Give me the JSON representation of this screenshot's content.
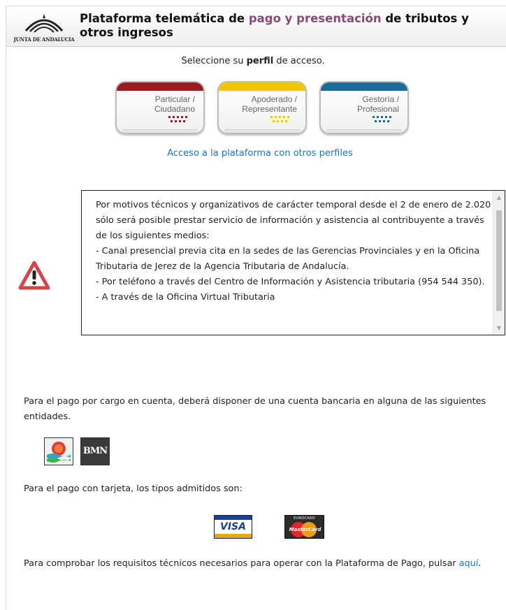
{
  "header": {
    "logo_text": "JUNTA DE ANDALUCIA",
    "title_part1": "Plataforma telemática de ",
    "title_highlight": "pago y presentación",
    "title_part2": " de tributos y otros ingresos",
    "highlight_color": "#8a4a78"
  },
  "profile_select": {
    "prefix": "Seleccione su ",
    "bold": "perfil",
    "suffix": " de acceso.",
    "profiles": [
      {
        "line1": "Particular /",
        "line2": "Ciudadano",
        "color": "#9b1c20"
      },
      {
        "line1": "Apoderado /",
        "line2": "Representante",
        "color": "#f5c400"
      },
      {
        "line1": "Gestoría /",
        "line2": "Profesional",
        "color": "#1c6a9a"
      }
    ],
    "other_profiles_link": "Acceso a la plataforma con otros perfiles"
  },
  "notice": {
    "icon": "warning-triangle-icon",
    "lines": [
      "Por motivos técnicos y organizativos de carácter temporal desde el 2 de enero de 2.020 sólo será posible prestar servicio de información y asistencia al contribuyente a través de los siguientes medios:",
      "- Canal presencial previa cita en la sedes de las Gerencias Provinciales y en la Oficina Tributaria de Jerez de la Agencia Tributaria de Andalucía.",
      "- Por teléfono a través del Centro de Información y Asistencia tributaria (954 544 350).",
      "- A través de la Oficina Virtual Tributaria"
    ]
  },
  "payment": {
    "bank_text": "Para el pago por cargo en cuenta, deberá disponer de una cuenta bancaria en alguna de las siguientes entidades.",
    "banks": [
      {
        "icon": "bank-sun-logo-icon"
      },
      {
        "name": "BMN"
      }
    ],
    "card_text": "Para el pago con tarjeta, los tipos admitidos son:",
    "cards": {
      "visa": "VISA",
      "mastercard_top": "EUROCARD",
      "mastercard_word": "MasterCard"
    },
    "requirements_text": "Para comprobar los requisitos técnicos necesarios para operar con la Plataforma de Pago, pulsar ",
    "requirements_link": "aquí",
    "requirements_end": "."
  }
}
